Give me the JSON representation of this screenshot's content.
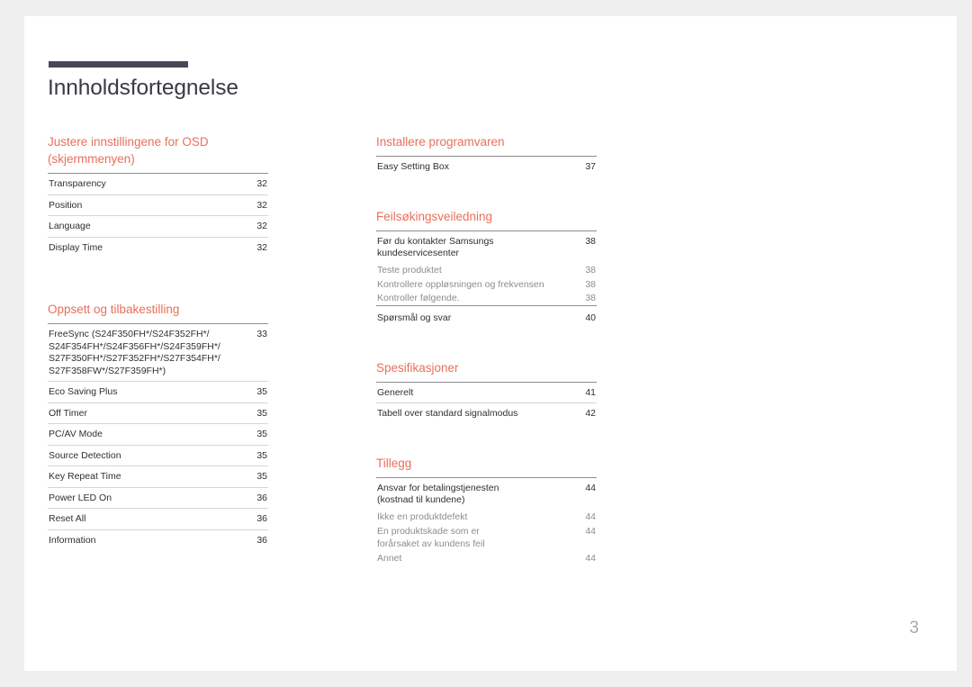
{
  "document": {
    "title": "Innholdsfortegnelse",
    "page_number": "3",
    "accent_color": "#e8705a",
    "rule_color": "#4a4654"
  },
  "left_column": {
    "sections": [
      {
        "title": "Justere innstillingene for OSD\n(skjermmenyen)",
        "entries": [
          {
            "label": "Transparency",
            "page": "32"
          },
          {
            "label": "Position",
            "page": "32"
          },
          {
            "label": "Language",
            "page": "32"
          },
          {
            "label": "Display Time",
            "page": "32"
          }
        ]
      },
      {
        "title": "Oppsett og tilbakestilling",
        "entries": [
          {
            "label": "FreeSync (S24F350FH*/S24F352FH*/\nS24F354FH*/S24F356FH*/S24F359FH*/\nS27F350FH*/S27F352FH*/S27F354FH*/\nS27F358FW*/S27F359FH*)",
            "page": "33"
          },
          {
            "label": "Eco Saving Plus",
            "page": "35"
          },
          {
            "label": "Off Timer",
            "page": "35"
          },
          {
            "label": "PC/AV Mode",
            "page": "35"
          },
          {
            "label": "Source Detection",
            "page": "35"
          },
          {
            "label": "Key Repeat Time",
            "page": "35"
          },
          {
            "label": "Power LED On",
            "page": "36"
          },
          {
            "label": "Reset All",
            "page": "36"
          },
          {
            "label": "Information",
            "page": "36"
          }
        ]
      }
    ]
  },
  "right_column": {
    "sections": [
      {
        "title": "Installere programvaren",
        "entries": [
          {
            "label": "Easy Setting Box",
            "page": "37"
          }
        ]
      },
      {
        "title": "Feilsøkingsveiledning",
        "entries": [
          {
            "label": "Før du kontakter Samsungs\nkundeservicesenter",
            "page": "38"
          },
          {
            "label": "Teste produktet",
            "page": "38"
          },
          {
            "label": "Kontrollere oppløsningen og frekvensen",
            "page": "38"
          },
          {
            "label": "Kontroller følgende.",
            "page": "38"
          },
          {
            "label": "Spørsmål og svar",
            "page": "40"
          }
        ]
      },
      {
        "title": "Spesifikasjoner",
        "entries": [
          {
            "label": "Generelt",
            "page": "41"
          },
          {
            "label": "Tabell over standard signalmodus",
            "page": "42"
          }
        ]
      },
      {
        "title": "Tillegg",
        "entries": [
          {
            "label": "Ansvar for betalingstjenesten\n(kostnad til kundene)",
            "page": "44"
          },
          {
            "label": "Ikke en produktdefekt",
            "page": "44"
          },
          {
            "label": "En produktskade som er\nforårsaket av kundens feil",
            "page": "44"
          },
          {
            "label": "Annet",
            "page": "44"
          }
        ]
      }
    ]
  }
}
